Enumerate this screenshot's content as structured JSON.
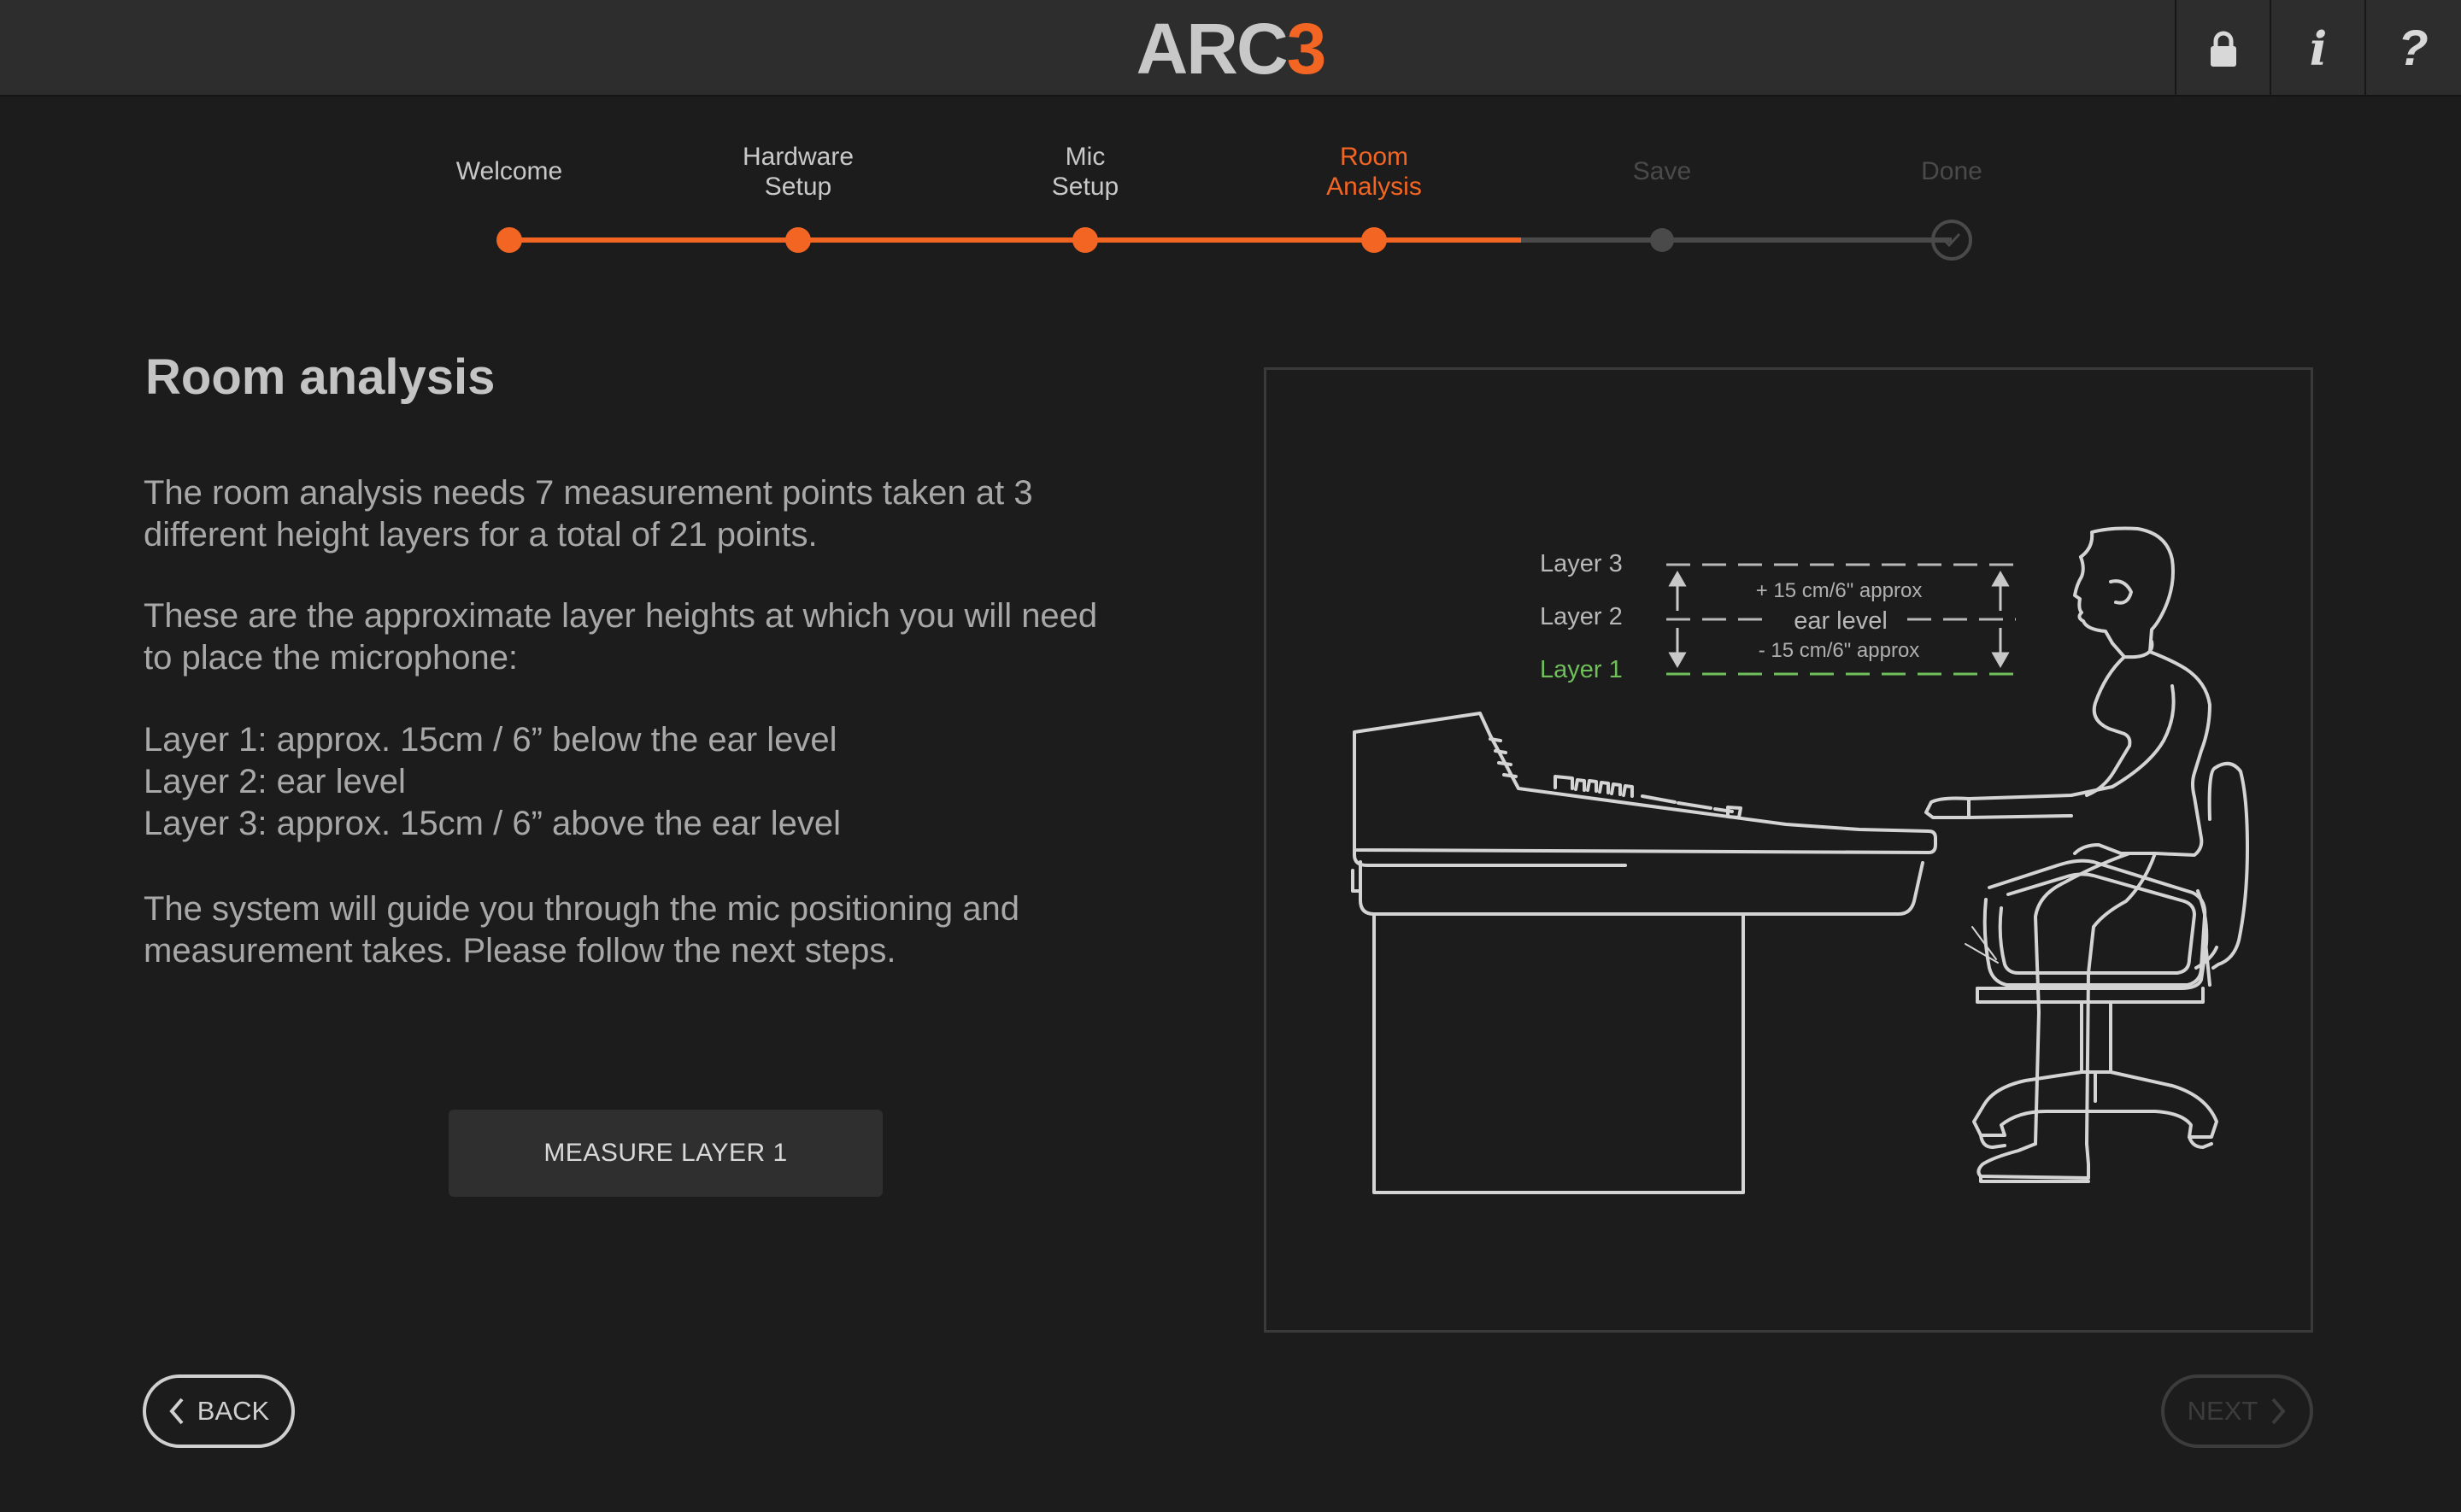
{
  "header": {
    "logo_main": "ARC",
    "logo_accent": "3",
    "icons": [
      "lock-icon",
      "info-icon",
      "help-icon"
    ],
    "info_glyph": "i",
    "help_glyph": "?"
  },
  "colors": {
    "accent": "#f26522",
    "background": "#1c1c1c",
    "header": "#2d2d2d",
    "inactive": "#4a4a4a",
    "layer1": "#6fbf5a"
  },
  "steps": [
    {
      "line1": "Welcome",
      "line2": "",
      "state": "done"
    },
    {
      "line1": "Hardware",
      "line2": "Setup",
      "state": "done"
    },
    {
      "line1": "Mic",
      "line2": "Setup",
      "state": "done"
    },
    {
      "line1": "Room",
      "line2": "Analysis",
      "state": "current"
    },
    {
      "line1": "Save",
      "line2": "",
      "state": "future"
    },
    {
      "line1": "Done",
      "line2": "",
      "state": "future"
    }
  ],
  "main": {
    "title": "Room analysis",
    "p1_line1": "The room analysis needs 7 measurement points taken at 3",
    "p1_line2": "different height layers for a total of 21 points.",
    "p2_line1": "These are the approximate layer heights at which you will need",
    "p2_line2": "to place the microphone:",
    "layer1": "Layer 1: approx. 15cm / 6” below the ear level",
    "layer2": "Layer 2: ear level",
    "layer3": "Layer 3: approx. 15cm / 6” above the ear level",
    "p4_line1": "The system will guide you through the mic positioning and",
    "p4_line2": "measurement takes. Please follow the next steps.",
    "measure_button": "MEASURE LAYER 1"
  },
  "illustration": {
    "layer3_label": "Layer 3",
    "layer2_label": "Layer 2",
    "layer1_label": "Layer 1",
    "above_note": "+ 15 cm/6\" approx",
    "ear_level": "ear level",
    "below_note": "- 15 cm/6\" approx"
  },
  "nav": {
    "back_label": "BACK",
    "next_label": "NEXT"
  }
}
